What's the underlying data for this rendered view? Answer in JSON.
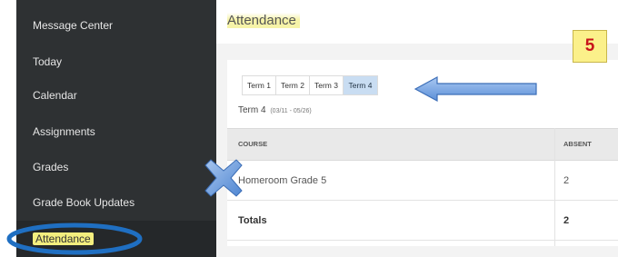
{
  "sidebar": {
    "items": [
      {
        "label": "Message Center"
      },
      {
        "label": "Today"
      },
      {
        "label": "Calendar"
      },
      {
        "label": "Assignments"
      },
      {
        "label": "Grades"
      },
      {
        "label": "Grade Book Updates"
      },
      {
        "label": "Attendance",
        "active": true
      }
    ]
  },
  "header": {
    "title": "Attendance"
  },
  "badge": {
    "text": "5"
  },
  "tabs": [
    {
      "label": "Term 1"
    },
    {
      "label": "Term 2"
    },
    {
      "label": "Term 3"
    },
    {
      "label": "Term 4",
      "selected": true
    }
  ],
  "term": {
    "name": "Term 4",
    "dates": "(03/11 - 05/26)"
  },
  "table": {
    "columns": [
      "COURSE",
      "ABSENT"
    ],
    "rows": [
      {
        "course": "Homeroom Grade 5",
        "absent": "2"
      }
    ],
    "totals": {
      "label": "Totals",
      "absent": "2"
    }
  },
  "colors": {
    "sidebar_bg": "#2e3133",
    "selected_tab": "#c9ddf2",
    "arrow": "#6e9fe0",
    "highlight": "#f3ee7e",
    "badge_text": "#c8141b",
    "ellipse": "#1f6fc2"
  }
}
